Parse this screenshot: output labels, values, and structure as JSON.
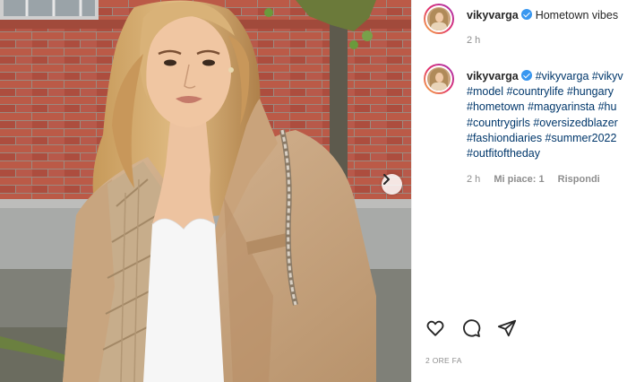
{
  "post": {
    "username": "vikyvarga",
    "header_caption": "Hometown vibes",
    "header_time": "2 h"
  },
  "comment": {
    "username": "vikyvarga",
    "lines": [
      "#vikyvarga #vikyv",
      "#model #countrylife #hungary",
      "#hometown #magyarinsta #hu",
      "#countrygirls #oversizedblazer",
      "#fashiondiaries #summer2022",
      "#outfitoftheday"
    ],
    "time": "2 h",
    "likes": "Mi piace: 1",
    "reply": "Rispondi"
  },
  "footer": {
    "timestamp": "2 ORE FA"
  },
  "icons": {
    "like": "heart-icon",
    "comment": "comment-icon",
    "share": "send-icon",
    "next": "chevron-right-icon",
    "verified": "verified-badge-icon"
  },
  "colors": {
    "link": "#00376b",
    "verified": "#3897f0",
    "muted": "#8e8e8e"
  }
}
